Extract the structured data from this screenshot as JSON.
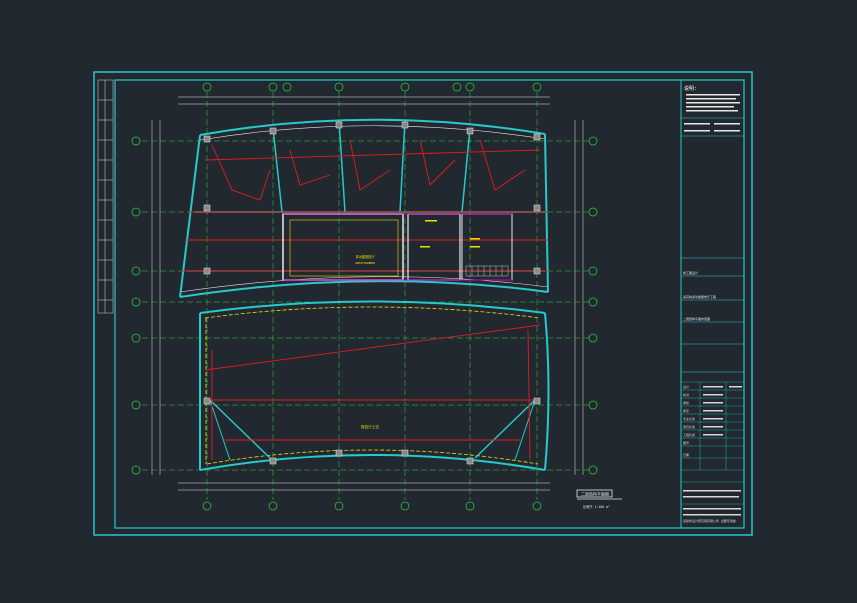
{
  "drawing": {
    "grid_top": [
      "④",
      "④",
      "⑤",
      "⑦",
      "⑩",
      "⑪",
      "⑬"
    ],
    "grid_bottom": [
      "④",
      "⑤",
      "⑦",
      "⑩",
      "⑫",
      "⑬"
    ],
    "grid_left": [
      "⑯",
      "⑮",
      "⑭",
      "⑬",
      "Ⓐ",
      "Ⓑ",
      "Ⓒ"
    ],
    "grid_right": [
      "⑯",
      "⑮",
      "⑭",
      "⑬",
      "Ⓐ",
      "Ⓑ",
      "Ⓒ"
    ],
    "room_main": "多功能报告厅",
    "room_sub": "ANTECHAMBER",
    "hall_label": "报告厅上空",
    "plan_title": "二层结构平面图",
    "scale_note": "比例尺 1:100  m²"
  },
  "title_block": {
    "notes_header": "说明:",
    "project": "某高校多功能报告厅工程",
    "drawing_name": "二层结构平面布置图",
    "stage": "施工图设计",
    "rows": [
      "设计",
      "校对",
      "审核",
      "审定",
      "专业负责",
      "项目负责",
      "工程负责",
      "图号",
      "日期"
    ],
    "footer": "某建筑设计研究院有限公司  出图专用章"
  },
  "colors": {
    "background": "#222830",
    "frame": "#27c9c9",
    "beam": "#e01e1e",
    "wall": "#d4d4d4"
  }
}
